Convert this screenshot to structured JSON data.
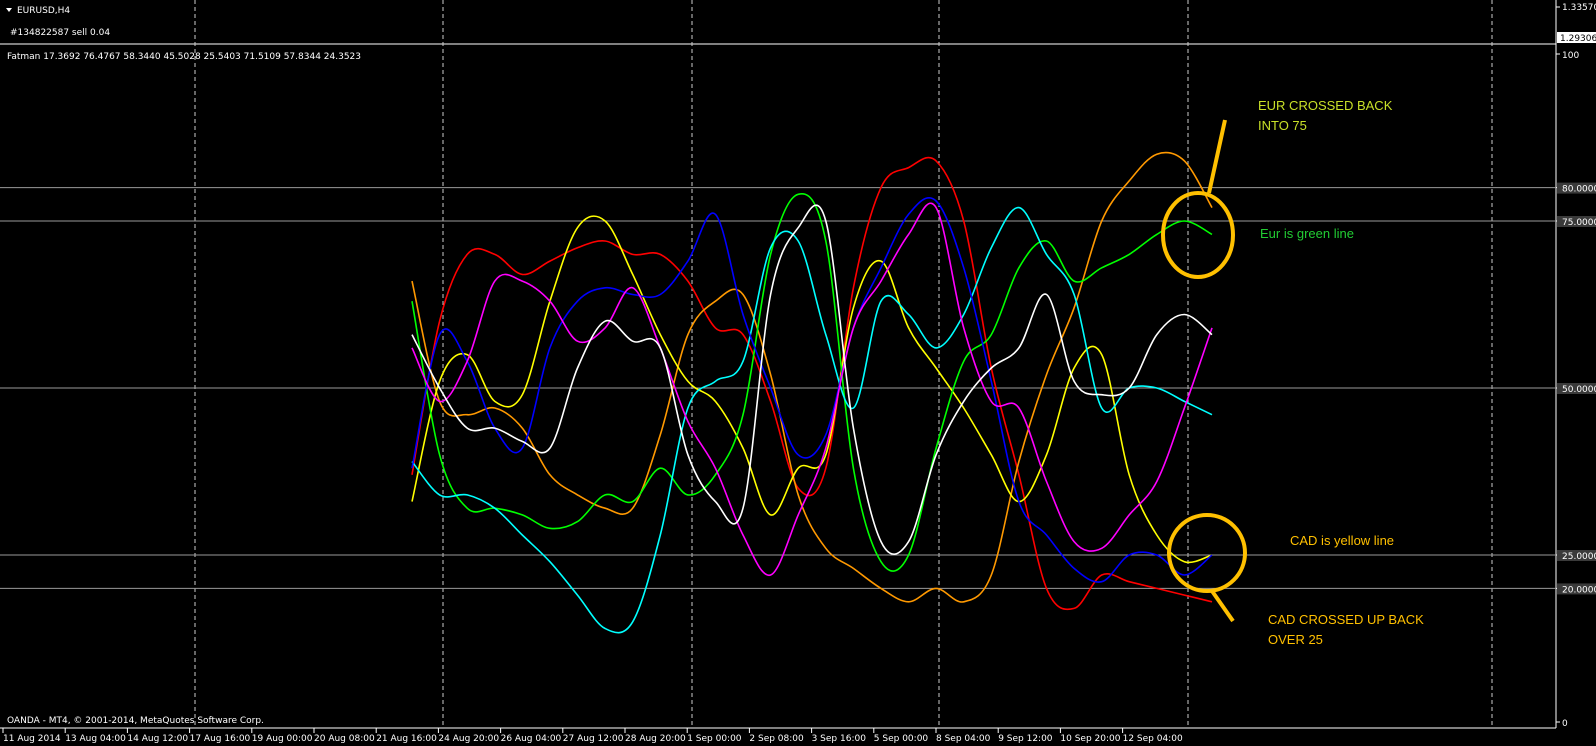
{
  "window": {
    "symbol_title": "EURUSD,H4",
    "order_line": "#134822587 sell 0.04",
    "price_top": "1.33570",
    "price_current": "1.29306",
    "copyright": "OANDA - MT4, © 2001-2014, MetaQuotes Software Corp."
  },
  "indicator": {
    "label": "Fatman 17.3692 76.4767 58.3440 45.5028 25.5403 71.5109 57.8344 24.3523"
  },
  "chart_data": {
    "type": "line",
    "y_range": [
      0,
      100
    ],
    "y_axis_labels": [
      "100",
      "80.00000",
      "75.00000",
      "50.00000",
      "25.00000",
      "20.00000",
      "0"
    ],
    "levels": [
      80,
      75,
      50,
      25,
      20
    ],
    "x_tick_labels": [
      "11 Aug 2014",
      "13 Aug 04:00",
      "14 Aug 12:00",
      "17 Aug 16:00",
      "19 Aug 00:00",
      "20 Aug 08:00",
      "21 Aug 16:00",
      "24 Aug 20:00",
      "26 Aug 04:00",
      "27 Aug 12:00",
      "28 Aug 20:00",
      "1 Sep 00:00",
      "2 Sep 08:00",
      "3 Sep 16:00",
      "5 Sep 00:00",
      "8 Sep 04:00",
      "9 Sep 12:00",
      "10 Sep 20:00",
      "12 Sep 04:00"
    ],
    "series": [
      {
        "color": "#ff0000",
        "values": [
          37,
          60,
          70,
          70,
          67,
          69,
          71,
          72,
          70,
          70,
          66,
          59,
          58,
          48,
          35,
          38,
          65,
          80,
          83,
          84,
          75,
          53,
          37,
          20,
          17,
          22,
          21,
          20,
          19,
          18
        ]
      },
      {
        "color": "#ff9900",
        "values": [
          66,
          48,
          46,
          47,
          44,
          37,
          34,
          32,
          32,
          43,
          58,
          63,
          64,
          52,
          34,
          26,
          23,
          20,
          18,
          20,
          18,
          22,
          39,
          52,
          62,
          75,
          81,
          85,
          84,
          77
        ]
      },
      {
        "color": "#ffff00",
        "values": [
          33,
          51,
          55,
          48,
          49,
          63,
          74,
          75,
          67,
          58,
          51,
          48,
          41,
          31,
          38,
          40,
          62,
          69,
          59,
          53,
          47,
          40,
          33,
          40,
          53,
          55,
          37,
          28,
          24,
          25
        ]
      },
      {
        "color": "#00ff00",
        "values": [
          63,
          40,
          32,
          32,
          31,
          29,
          30,
          34,
          33,
          38,
          34,
          37,
          46,
          70,
          79,
          72,
          38,
          24,
          25,
          41,
          54,
          58,
          68,
          72,
          66,
          68,
          70,
          73,
          75,
          73
        ]
      },
      {
        "color": "#00ffff",
        "values": [
          39,
          34,
          34,
          32,
          28,
          24,
          19,
          14,
          15,
          28,
          47,
          51,
          54,
          71,
          72,
          58,
          47,
          63,
          61,
          56,
          61,
          71,
          77,
          70,
          64,
          47,
          50,
          50,
          48,
          46
        ]
      },
      {
        "color": "#0000ff",
        "values": [
          38,
          58,
          54,
          44,
          41,
          56,
          63,
          65,
          64,
          64,
          69,
          76,
          61,
          50,
          40,
          43,
          59,
          68,
          76,
          78,
          68,
          51,
          33,
          28,
          23,
          21,
          25,
          25,
          22,
          25
        ]
      },
      {
        "color": "#ff00ff",
        "values": [
          56,
          48,
          54,
          66,
          66,
          63,
          57,
          59,
          65,
          56,
          45,
          38,
          28,
          22,
          31,
          41,
          59,
          66,
          73,
          77,
          59,
          48,
          47,
          36,
          27,
          26,
          31,
          36,
          47,
          59
        ]
      },
      {
        "color": "#ffffff",
        "values": [
          58,
          50,
          44,
          44,
          42,
          41,
          53,
          60,
          57,
          56,
          40,
          33,
          32,
          64,
          74,
          75,
          44,
          27,
          27,
          40,
          48,
          53,
          56,
          64,
          51,
          49,
          50,
          58,
          61,
          58
        ]
      }
    ]
  },
  "annotations": {
    "eur_crossed_line1": "EUR CROSSED BACK",
    "eur_crossed_line2": "INTO 75",
    "eur_green": "Eur is green line",
    "cad_yellow": "CAD   is yellow line",
    "cad_crossed_line1": "CAD CROSSED UP BACK",
    "cad_crossed_line2": "OVER 25"
  }
}
